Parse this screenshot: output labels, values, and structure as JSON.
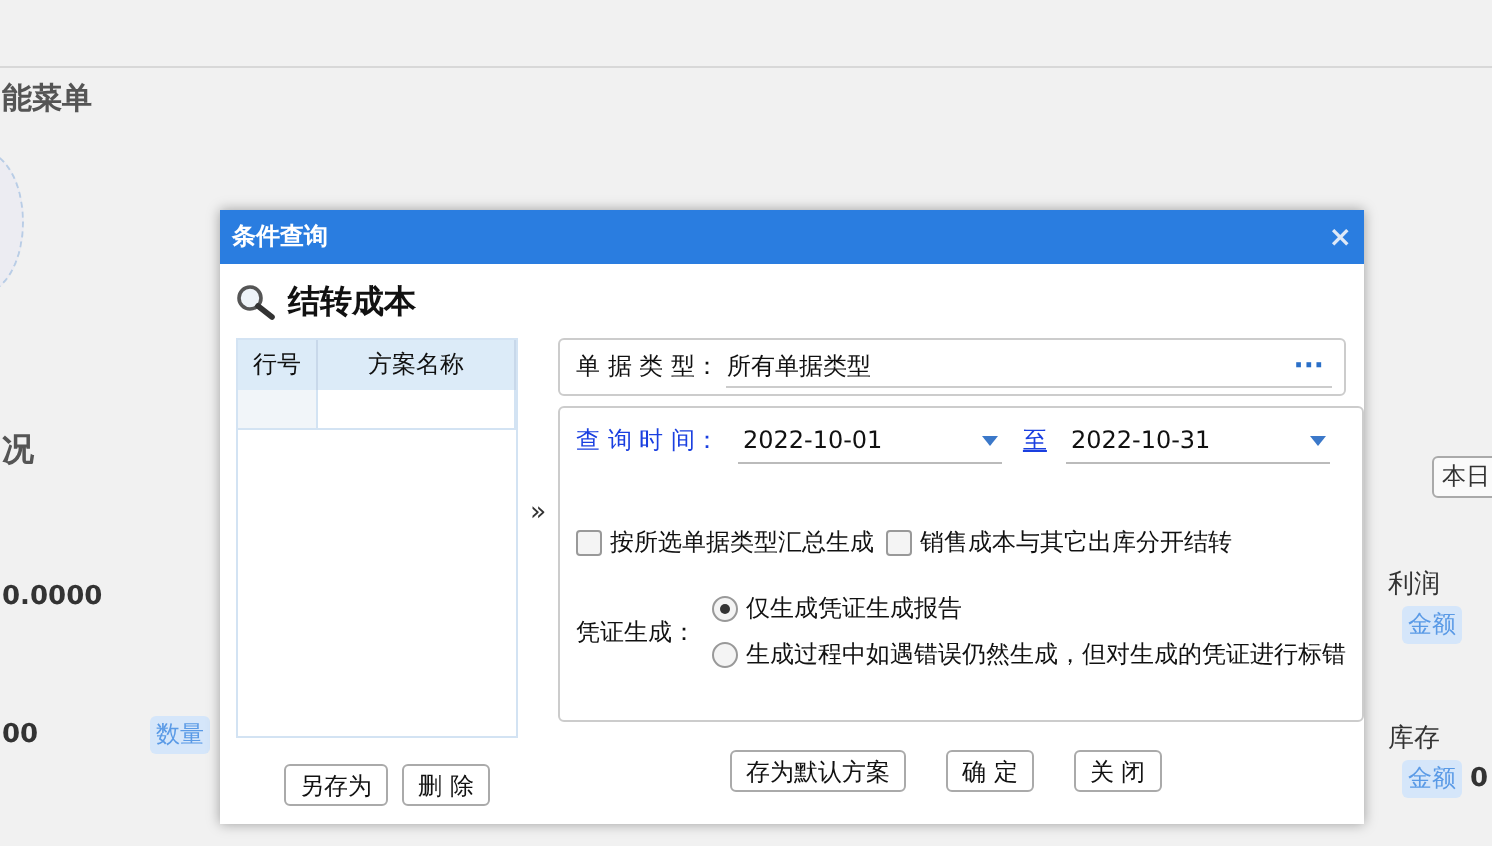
{
  "background": {
    "menu_heading": "能菜单",
    "section_heading": "况",
    "amount": "0.0000",
    "quantity": "00",
    "quantity_tag": "数量",
    "today_button": "本日",
    "profit_label": "利润",
    "profit_tag": "金额",
    "stock_label": "库存",
    "stock_tag": "金额",
    "stock_value": "0"
  },
  "dialog": {
    "title": "条件查询",
    "close": "×",
    "heading": "结转成本",
    "plans": {
      "columns": [
        "行号",
        "方案名称"
      ],
      "rows": [
        {
          "selected": false,
          "cells": [
            "",
            ""
          ]
        }
      ]
    },
    "plan_buttons": [
      "另存为",
      "删 除"
    ],
    "collapse": "»",
    "doc_type": {
      "label": "单 据 类 型：",
      "value": "所有单据类型",
      "more": "···"
    },
    "query_time": {
      "label": "查 询 时 间：",
      "from": "2022-10-01",
      "to_label": "至",
      "to": "2022-10-31"
    },
    "options": [
      {
        "label": "按所选单据类型汇总生成",
        "checked": false
      },
      {
        "label": "销售成本与其它出库分开结转",
        "checked": false
      }
    ],
    "voucher": {
      "label": "凭证生成：",
      "choices": [
        {
          "label": "仅生成凭证生成报告",
          "selected": true
        },
        {
          "label": "生成过程中如遇错误仍然生成，但对生成的凭证进行标错",
          "selected": false
        }
      ]
    },
    "buttons": [
      "存为默认方案",
      "确 定",
      "关 闭"
    ]
  }
}
